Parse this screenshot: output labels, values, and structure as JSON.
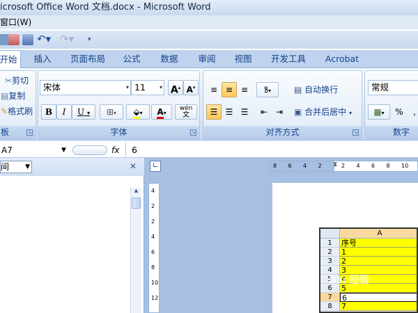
{
  "window": {
    "title": "icrosoft Office Word 文档.docx - Microsoft Word"
  },
  "menu": {
    "window_label": "窗口(W)"
  },
  "tabs": [
    "开始",
    "插入",
    "页面布局",
    "公式",
    "数据",
    "审阅",
    "视图",
    "开发工具",
    "Acrobat"
  ],
  "ribbon": {
    "clipboard": {
      "cut": "剪切",
      "copy": "复制",
      "format_painter": "格式刷",
      "label": "板"
    },
    "font": {
      "name": "宋体",
      "size": "11",
      "bold": "B",
      "italic": "I",
      "underline": "U",
      "grow": "A",
      "shrink": "A",
      "font_color": "A",
      "phonetic": "wén",
      "phonetic_char": "文",
      "label": "字体"
    },
    "alignment": {
      "wrap_text": "自动换行",
      "merge_center": "合并后居中",
      "label": "对齐方式"
    },
    "number": {
      "format": "常规",
      "percent": "%",
      "comma": ",",
      "label": "数字"
    }
  },
  "formula_bar": {
    "name_box": "A7",
    "fx": "fx",
    "value": "6"
  },
  "task_pane": {
    "dropdown_value": "间",
    "close": "✕"
  },
  "rulers": {
    "horizontal_ticks": [
      "8",
      "6",
      "4",
      "2",
      "2",
      "4",
      "6",
      "8",
      "10"
    ],
    "vertical_ticks": [
      "4",
      "2",
      "2",
      "4",
      "6",
      "8",
      "10",
      "12"
    ]
  },
  "spreadsheet": {
    "column_header": "A",
    "rows": [
      {
        "num": "1",
        "value": "序号"
      },
      {
        "num": "2",
        "value": "1"
      },
      {
        "num": "3",
        "value": "2"
      },
      {
        "num": "4",
        "value": "3"
      },
      {
        "num": "5",
        "value": "4"
      },
      {
        "num": "6",
        "value": "5"
      },
      {
        "num": "7",
        "value": "6"
      },
      {
        "num": "8",
        "value": "7"
      }
    ]
  },
  "watermark": "Bai 经验",
  "colors": {
    "ribbon_blue": "#bfd3ee",
    "cell_highlight": "#ffff00",
    "doc_background": "#a6bfe2"
  }
}
